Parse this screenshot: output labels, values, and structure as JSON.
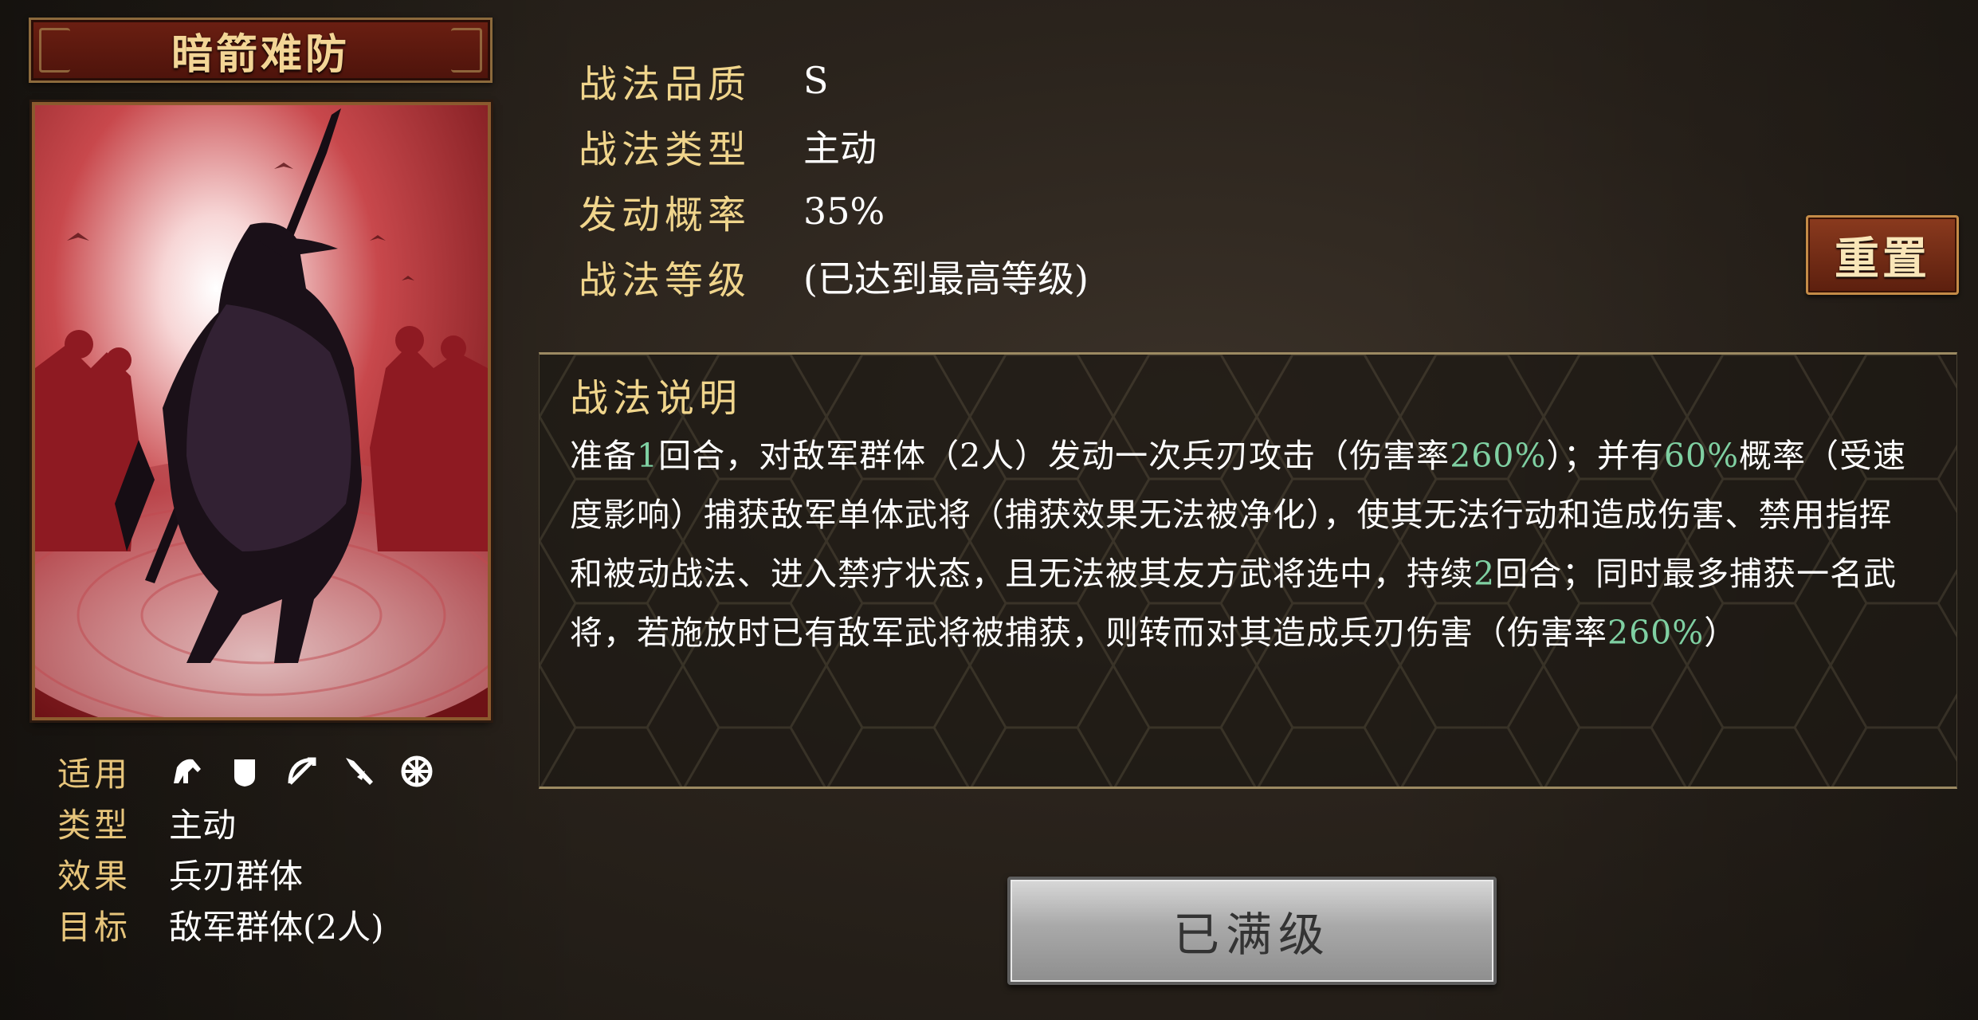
{
  "skill": {
    "name": "暗箭难防"
  },
  "attributes": [
    {
      "key": "战法品质",
      "value": "S"
    },
    {
      "key": "战法类型",
      "value": "主动"
    },
    {
      "key": "发动概率",
      "value": "35%"
    },
    {
      "key": "战法等级",
      "value": "(已达到最高等级)"
    }
  ],
  "reset_button": "重置",
  "description": {
    "title": "战法说明",
    "segments": [
      {
        "t": "准备",
        "hl": false
      },
      {
        "t": "1",
        "hl": true
      },
      {
        "t": "回合，对敌军群体（2人）发动一次兵刃攻击（伤害率",
        "hl": false
      },
      {
        "t": "260%",
        "hl": true
      },
      {
        "t": "）；并有",
        "hl": false
      },
      {
        "t": "60%",
        "hl": true
      },
      {
        "t": "概率（受速度影响）捕获敌军单体武将（捕获效果无法被净化），使其无法行动和造成伤害、禁用指挥和被动战法、进入禁疗状态，且无法被其友方武将选中，持续",
        "hl": false
      },
      {
        "t": "2",
        "hl": true
      },
      {
        "t": "回合；同时最多捕获一名武将，若施放时已有敌军武将被捕获，则转而对其造成兵刃伤害（伤害率",
        "hl": false
      },
      {
        "t": "260%",
        "hl": true
      },
      {
        "t": "）",
        "hl": false
      }
    ]
  },
  "info": {
    "applicable_label": "适用",
    "troop_icons": [
      "cavalry-icon",
      "shield-icon",
      "archer-icon",
      "spear-icon",
      "siege-icon"
    ],
    "type_label": "类型",
    "type_value": "主动",
    "effect_label": "效果",
    "effect_value": "兵刃群体",
    "target_label": "目标",
    "target_value": "敌军群体(2人)"
  },
  "max_level_button": "已满级",
  "colors": {
    "gold": "#f0d58c",
    "highlight_green": "#7fd0a2",
    "banner_red": "#5c190e"
  }
}
